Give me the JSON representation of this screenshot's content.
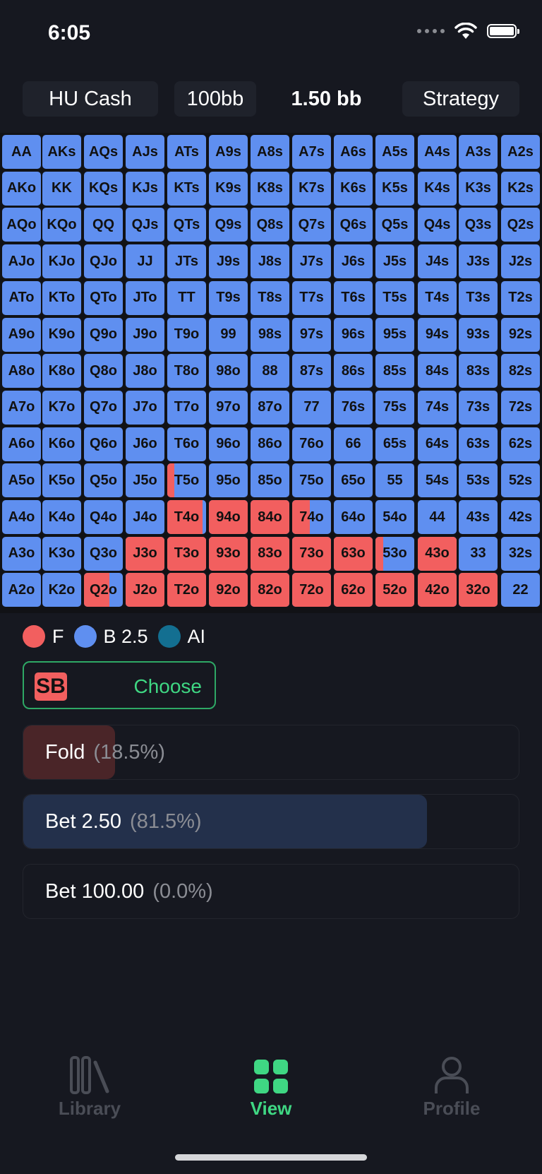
{
  "status_bar": {
    "time": "6:05"
  },
  "header": {
    "game_type": "HU Cash",
    "stack": "100bb",
    "bet_size": "1.50 bb",
    "mode": "Strategy"
  },
  "grid": {
    "ranks": [
      "A",
      "K",
      "Q",
      "J",
      "T",
      "9",
      "8",
      "7",
      "6",
      "5",
      "4",
      "3",
      "2"
    ],
    "fold_fractions": {
      "T5o": 0.18,
      "T4o": 0.9,
      "94o": 1,
      "84o": 1,
      "74o": 0.45,
      "J3o": 1,
      "T3o": 1,
      "93o": 1,
      "83o": 1,
      "73o": 1,
      "63o": 1,
      "53o": 0.2,
      "43o": 1,
      "Q2o": 0.65,
      "J2o": 1,
      "T2o": 1,
      "92o": 1,
      "82o": 1,
      "72o": 1,
      "62o": 1,
      "52o": 1,
      "42o": 1,
      "32o": 1
    }
  },
  "legend": [
    {
      "label": "F",
      "color": "#f25f5f"
    },
    {
      "label": "B 2.5",
      "color": "#5f8ff0"
    },
    {
      "label": "AI",
      "color": "#136f91"
    }
  ],
  "position_selector": {
    "position": "SB",
    "action_label": "Choose"
  },
  "actions": [
    {
      "label": "Fold",
      "percent_text": "(18.5%)",
      "fraction": 0.185,
      "color": "#4a2528"
    },
    {
      "label": "Bet 2.50",
      "percent_text": "(81.5%)",
      "fraction": 0.815,
      "color": "#23304b"
    },
    {
      "label": "Bet 100.00",
      "percent_text": "(0.0%)",
      "fraction": 0.0,
      "color": "#1d3a44"
    }
  ],
  "tabs": [
    {
      "label": "Library",
      "icon": "library-icon",
      "active": false
    },
    {
      "label": "View",
      "icon": "grid-icon",
      "active": true
    },
    {
      "label": "Profile",
      "icon": "person-icon",
      "active": false
    }
  ],
  "colors": {
    "fold": "#f25f5f",
    "bet": "#5f8ff0",
    "allin": "#136f91",
    "accent_green": "#3fd783",
    "inactive_tab": "#4a4d56"
  }
}
